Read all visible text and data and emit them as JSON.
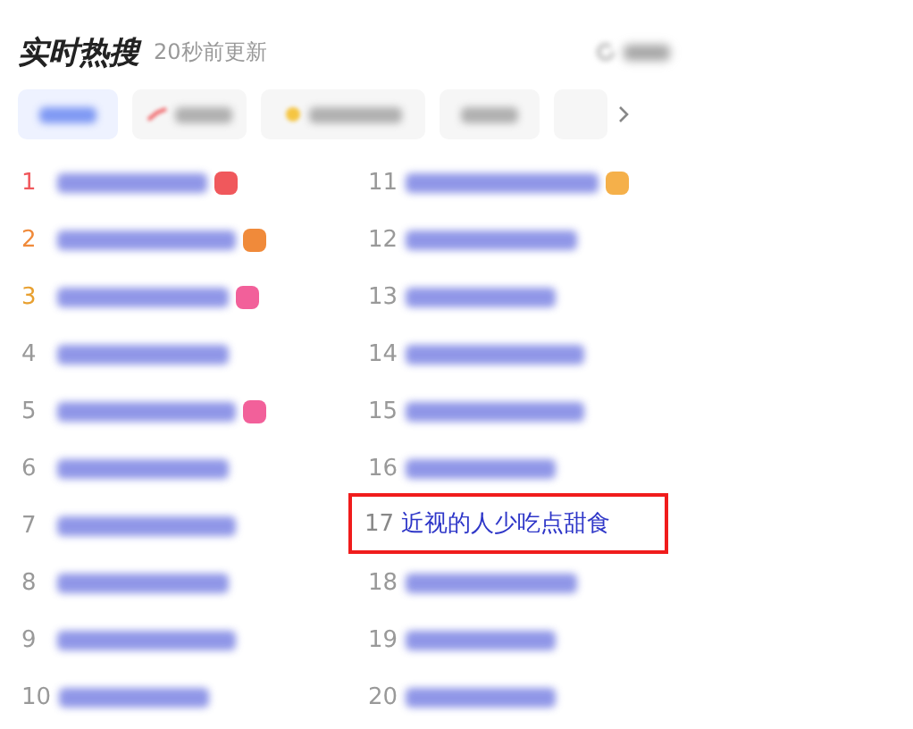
{
  "header": {
    "title": "实时热搜",
    "updated": "20秒前更新"
  },
  "tabs": [
    {
      "kind": "plain",
      "selected": true
    },
    {
      "kind": "trend",
      "selected": false
    },
    {
      "kind": "star",
      "selected": false
    },
    {
      "kind": "plain",
      "selected": false
    }
  ],
  "rows": [
    {
      "rank": "1",
      "color": "#f0585c"
    },
    {
      "rank": "2",
      "color": "#f08a3a"
    },
    {
      "rank": "3",
      "color": "#f2609a"
    },
    {
      "rank": "4"
    },
    {
      "rank": "5",
      "color": "#f2609a"
    },
    {
      "rank": "6"
    },
    {
      "rank": "7"
    },
    {
      "rank": "8"
    },
    {
      "rank": "9"
    },
    {
      "rank": "10"
    },
    {
      "rank": "11",
      "color": "#f5b04a"
    },
    {
      "rank": "12"
    },
    {
      "rank": "13"
    },
    {
      "rank": "14"
    },
    {
      "rank": "15"
    },
    {
      "rank": "16"
    },
    {
      "rank": "17",
      "title": "近视的人少吃点甜食",
      "highlighted": true
    },
    {
      "rank": "18"
    },
    {
      "rank": "19"
    },
    {
      "rank": "20"
    }
  ]
}
